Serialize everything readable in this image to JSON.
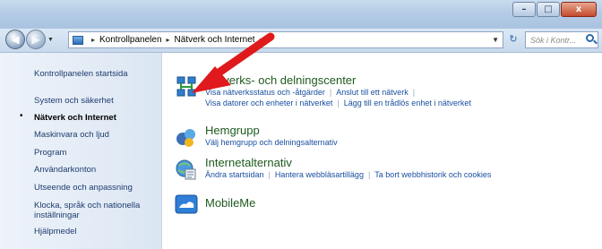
{
  "window": {
    "min_label": "–",
    "max_label": "□",
    "close_label": "x"
  },
  "nav": {
    "back_label": "◀",
    "forward_label": "▶",
    "address": {
      "crumb1": "Kontrollpanelen",
      "crumb2": "Nätverk och Internet",
      "separator": "▸"
    },
    "search_placeholder": "Sök i Kontr..."
  },
  "sidebar": {
    "items": [
      {
        "label": "Kontrollpanelen startsida"
      },
      {
        "label": "System och säkerhet"
      },
      {
        "label": "Nätverk och Internet"
      },
      {
        "label": "Maskinvara och ljud"
      },
      {
        "label": "Program"
      },
      {
        "label": "Användarkonton"
      },
      {
        "label": "Utseende och anpassning"
      },
      {
        "label": "Klocka, språk och nationella"
      },
      {
        "label": "inställningar"
      },
      {
        "label": "Hjälpmedel"
      }
    ]
  },
  "categories": [
    {
      "title": "Nätverks- och delningscenter",
      "links_row1": [
        "Visa nätverksstatus och -åtgärder",
        "Anslut till ett nätverk"
      ],
      "links_row2": [
        "Visa datorer och enheter i nätverket",
        "Lägg till en trådlös enhet i nätverket"
      ]
    },
    {
      "title": "Hemgrupp",
      "links_row1": [
        "Välj hemgrupp och delningsalternativ"
      ]
    },
    {
      "title": "Internetalternativ",
      "links_row1": [
        "Ändra startsidan",
        "Hantera webbläsartillägg",
        "Ta bort webbhistorik och cookies"
      ]
    },
    {
      "title": "MobileMe"
    }
  ],
  "colors": {
    "link": "#1a4fa0",
    "category_title": "#1e5a1e",
    "annotation_arrow": "#e0191c"
  },
  "icons": [
    "network-center-icon",
    "homegroup-icon",
    "internet-options-icon",
    "mobileme-icon"
  ]
}
